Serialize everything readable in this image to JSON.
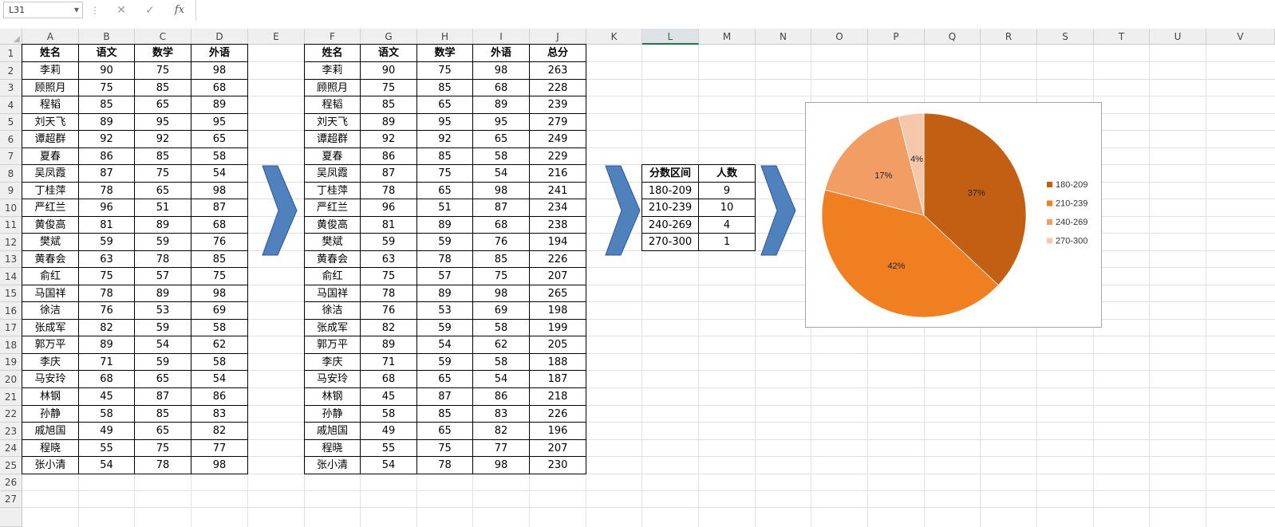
{
  "name_box": {
    "value": "L31"
  },
  "formula_bar": {
    "cancel_icon": "cancel-x-icon",
    "enter_icon": "checkmark-icon",
    "fx_label": "fx",
    "value": ""
  },
  "columns": [
    "A",
    "B",
    "C",
    "D",
    "E",
    "F",
    "G",
    "H",
    "I",
    "J",
    "K",
    "L",
    "M",
    "N",
    "O",
    "P",
    "Q",
    "R",
    "S",
    "T",
    "U",
    "V"
  ],
  "selected_column": "L",
  "rows": [
    "1",
    "2",
    "3",
    "4",
    "5",
    "6",
    "7",
    "8",
    "9",
    "10",
    "11",
    "12",
    "13",
    "14",
    "15",
    "16",
    "17",
    "18",
    "19",
    "20",
    "21",
    "22",
    "23",
    "24",
    "25",
    "26",
    "27"
  ],
  "table1": {
    "headers": [
      "姓名",
      "语文",
      "数学",
      "外语"
    ],
    "rows": [
      [
        "李莉",
        "90",
        "75",
        "98"
      ],
      [
        "顾照月",
        "75",
        "85",
        "68"
      ],
      [
        "程韬",
        "85",
        "65",
        "89"
      ],
      [
        "刘天飞",
        "89",
        "95",
        "95"
      ],
      [
        "谭超群",
        "92",
        "92",
        "65"
      ],
      [
        "夏春",
        "86",
        "85",
        "58"
      ],
      [
        "吴凤霞",
        "87",
        "75",
        "54"
      ],
      [
        "丁桂萍",
        "78",
        "65",
        "98"
      ],
      [
        "严红兰",
        "96",
        "51",
        "87"
      ],
      [
        "黄俊高",
        "81",
        "89",
        "68"
      ],
      [
        "樊斌",
        "59",
        "59",
        "76"
      ],
      [
        "黄春会",
        "63",
        "78",
        "85"
      ],
      [
        "俞红",
        "75",
        "57",
        "75"
      ],
      [
        "马国祥",
        "78",
        "89",
        "98"
      ],
      [
        "徐洁",
        "76",
        "53",
        "69"
      ],
      [
        "张成军",
        "82",
        "59",
        "58"
      ],
      [
        "郭万平",
        "89",
        "54",
        "62"
      ],
      [
        "李庆",
        "71",
        "59",
        "58"
      ],
      [
        "马安玲",
        "68",
        "65",
        "54"
      ],
      [
        "林钢",
        "45",
        "87",
        "86"
      ],
      [
        "孙静",
        "58",
        "85",
        "83"
      ],
      [
        "戚旭国",
        "49",
        "65",
        "82"
      ],
      [
        "程晓",
        "55",
        "75",
        "77"
      ],
      [
        "张小清",
        "54",
        "78",
        "98"
      ]
    ]
  },
  "table2": {
    "headers": [
      "姓名",
      "语文",
      "数学",
      "外语",
      "总分"
    ],
    "rows": [
      [
        "李莉",
        "90",
        "75",
        "98",
        "263"
      ],
      [
        "顾照月",
        "75",
        "85",
        "68",
        "228"
      ],
      [
        "程韬",
        "85",
        "65",
        "89",
        "239"
      ],
      [
        "刘天飞",
        "89",
        "95",
        "95",
        "279"
      ],
      [
        "谭超群",
        "92",
        "92",
        "65",
        "249"
      ],
      [
        "夏春",
        "86",
        "85",
        "58",
        "229"
      ],
      [
        "吴凤霞",
        "87",
        "75",
        "54",
        "216"
      ],
      [
        "丁桂萍",
        "78",
        "65",
        "98",
        "241"
      ],
      [
        "严红兰",
        "96",
        "51",
        "87",
        "234"
      ],
      [
        "黄俊高",
        "81",
        "89",
        "68",
        "238"
      ],
      [
        "樊斌",
        "59",
        "59",
        "76",
        "194"
      ],
      [
        "黄春会",
        "63",
        "78",
        "85",
        "226"
      ],
      [
        "俞红",
        "75",
        "57",
        "75",
        "207"
      ],
      [
        "马国祥",
        "78",
        "89",
        "98",
        "265"
      ],
      [
        "徐洁",
        "76",
        "53",
        "69",
        "198"
      ],
      [
        "张成军",
        "82",
        "59",
        "58",
        "199"
      ],
      [
        "郭万平",
        "89",
        "54",
        "62",
        "205"
      ],
      [
        "李庆",
        "71",
        "59",
        "58",
        "188"
      ],
      [
        "马安玲",
        "68",
        "65",
        "54",
        "187"
      ],
      [
        "林钢",
        "45",
        "87",
        "86",
        "218"
      ],
      [
        "孙静",
        "58",
        "85",
        "83",
        "226"
      ],
      [
        "戚旭国",
        "49",
        "65",
        "82",
        "196"
      ],
      [
        "程晓",
        "55",
        "75",
        "77",
        "207"
      ],
      [
        "张小清",
        "54",
        "78",
        "98",
        "230"
      ]
    ]
  },
  "table3": {
    "headers": [
      "分数区间",
      "人数"
    ],
    "rows": [
      [
        "180-209",
        "9"
      ],
      [
        "210-239",
        "10"
      ],
      [
        "240-269",
        "4"
      ],
      [
        "270-300",
        "1"
      ]
    ]
  },
  "arrow_icons": [
    "right-arrow-icon",
    "right-arrow-icon",
    "right-arrow-icon"
  ],
  "colors": {
    "arrow": "#4f81bd",
    "selected_header": "#217346"
  },
  "chart_data": {
    "type": "pie",
    "categories": [
      "180-209",
      "210-239",
      "240-269",
      "270-300"
    ],
    "values": [
      37,
      42,
      17,
      4
    ],
    "labels": [
      "37%",
      "42%",
      "17%",
      "4%"
    ],
    "colors": [
      "#c25f12",
      "#f07f22",
      "#f29d63",
      "#f6c7aa"
    ],
    "legend_position": "right"
  }
}
